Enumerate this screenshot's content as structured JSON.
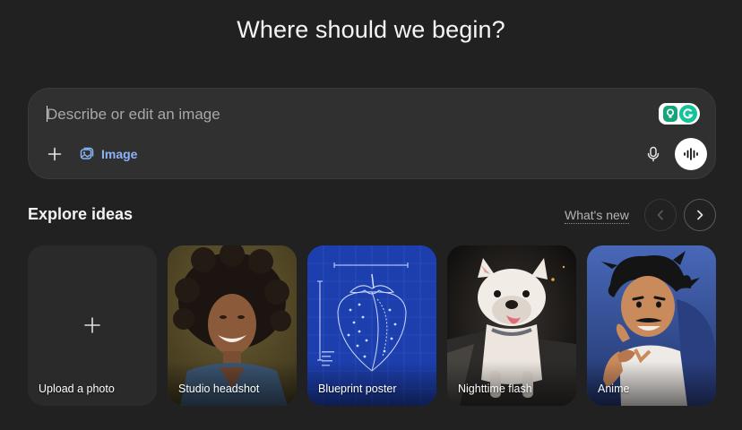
{
  "header": {
    "title": "Where should we begin?"
  },
  "composer": {
    "placeholder": "Describe or edit an image",
    "value": "",
    "image_chip_label": "Image",
    "icons": {
      "add": "plus-icon",
      "image": "image-icon",
      "mic": "microphone-icon",
      "voice": "voice-waveform-icon",
      "extension": "grammarly-icon"
    }
  },
  "explore": {
    "title": "Explore ideas",
    "whats_new_label": "What's new",
    "cards": [
      {
        "label": "Upload a photo"
      },
      {
        "label": "Studio headshot"
      },
      {
        "label": "Blueprint poster"
      },
      {
        "label": "Nighttime flash"
      },
      {
        "label": "Anime"
      }
    ]
  },
  "colors": {
    "background": "#212121",
    "composer": "#303030",
    "accent_link": "#8ab4f8",
    "extension": "#15c39a"
  }
}
